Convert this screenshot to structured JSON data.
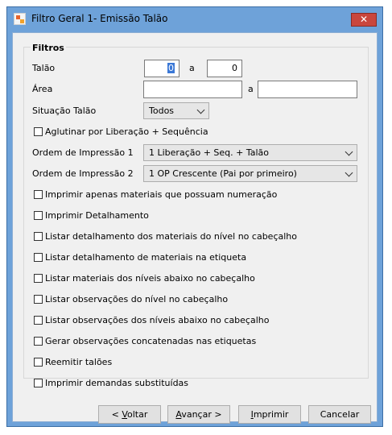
{
  "window": {
    "title": "Filtro Geral 1- Emissão Talão",
    "close_symbol": "✕"
  },
  "group": {
    "title": "Filtros"
  },
  "talao": {
    "label": "Talão",
    "from": "0",
    "sep": "a",
    "to": "0"
  },
  "area": {
    "label": "Área",
    "from": "",
    "sep": "a",
    "to": ""
  },
  "situacao": {
    "label": "Situação Talão",
    "value": "Todos"
  },
  "aglutinar": {
    "label": "Aglutinar por Liberação + Sequência",
    "checked": false
  },
  "ordem1": {
    "label": "Ordem de Impressão 1",
    "value": "1 Liberação + Seq. + Talão"
  },
  "ordem2": {
    "label": "Ordem de Impressão 2",
    "value": "1 OP Crescente (Pai por primeiro)"
  },
  "options": [
    {
      "label": "Imprimir apenas materiais que possuam numeração",
      "checked": false
    },
    {
      "label": "Imprimir Detalhamento",
      "checked": false
    },
    {
      "label": "Listar detalhamento dos materiais do nível no cabeçalho",
      "checked": false
    },
    {
      "label": "Listar detalhamento de materiais na etiqueta",
      "checked": false
    },
    {
      "label": "Listar materiais dos níveis abaixo no cabeçalho",
      "checked": false
    },
    {
      "label": "Listar observações do nível no cabeçalho",
      "checked": false
    },
    {
      "label": "Listar observações dos níveis abaixo no cabeçalho",
      "checked": false
    },
    {
      "label": "Gerar observações concatenadas nas etiquetas",
      "checked": false
    },
    {
      "label": "Reemitir talões",
      "checked": false
    },
    {
      "label": "Imprimir demandas substituídas",
      "checked": false
    }
  ],
  "buttons": {
    "back": {
      "pre": "< ",
      "key": "V",
      "rest": "oltar"
    },
    "next": {
      "pre": "",
      "key": "A",
      "rest": "vançar >"
    },
    "print": {
      "pre": "",
      "key": "I",
      "rest": "mprimir"
    },
    "cancel": {
      "label": "Cancelar"
    }
  },
  "colors": {
    "titlebar": "#6ea2d9",
    "client": "#f0f0f0",
    "close": "#c9463d",
    "selection": "#3b78d6"
  }
}
